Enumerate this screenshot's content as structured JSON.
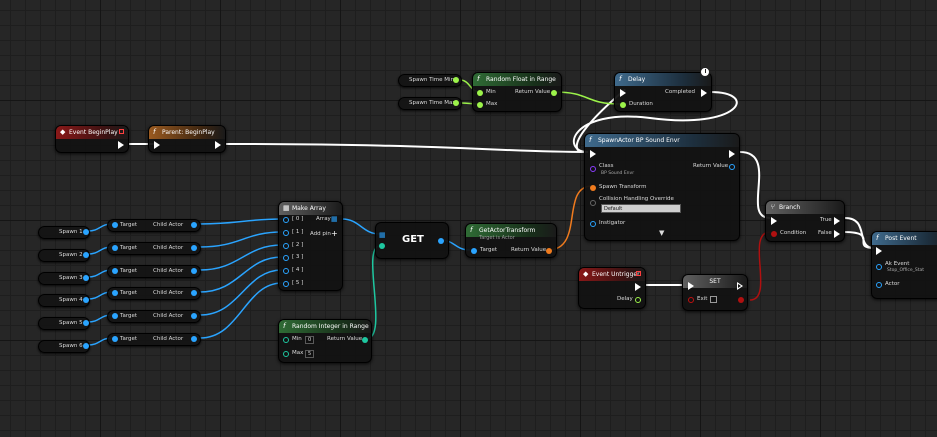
{
  "nodes": {
    "spawn_time_min": "Spawn Time Min",
    "spawn_time_max": "Spawn Time Max",
    "random_float": {
      "title": "Random Float in Range",
      "min": "Min",
      "max": "Max",
      "return": "Return Value"
    },
    "delay": {
      "title": "Delay",
      "completed": "Completed",
      "duration": "Duration"
    },
    "event_begin_play": "Event BeginPlay",
    "parent_begin_play": "Parent: BeginPlay",
    "spawn_actor": {
      "title": "SpawnActor BP Sound Envr",
      "class": "Class",
      "class_value": "BP Sound Envr",
      "return": "Return Value",
      "spawn_transform": "Spawn Transform",
      "collision": "Collision Handling Override",
      "collision_value": "Default",
      "instigator": "Instigator"
    },
    "spawns": [
      "Spawn 1",
      "Spawn 2",
      "Spawn 3",
      "Spawn 4",
      "Spawn 5",
      "Spawn 6"
    ],
    "child_actor": {
      "target": "Target",
      "child": "Child Actor"
    },
    "make_array": {
      "title": "Make Array",
      "pins": [
        "[ 0 ]",
        "[ 1 ]",
        "[ 2 ]",
        "[ 3 ]",
        "[ 4 ]",
        "[ 5 ]"
      ],
      "array": "Array",
      "add_pin": "Add pin"
    },
    "get": "GET",
    "get_actor_transform": {
      "title": "GetActorTransform",
      "subtitle": "Target is Actor",
      "target": "Target",
      "return": "Return Value"
    },
    "random_integer": {
      "title": "Random Integer in Range",
      "min": "Min",
      "min_value": "0",
      "max": "Max",
      "max_value": "5",
      "return": "Return Value"
    },
    "branch": {
      "title": "Branch",
      "condition": "Condition",
      "true": "True",
      "false": "False"
    },
    "event_untrigger": {
      "title": "Event Untrigger",
      "delay": "Delay"
    },
    "set": {
      "title": "SET",
      "exit": "Exit"
    },
    "post_event": {
      "title": "Post Event",
      "ak_event": "Ak Event",
      "ak_event_value": "Stop_Office_Stat",
      "actor": "Actor"
    }
  },
  "colors": {
    "exec": "#ffffff",
    "object": "#2aa4ff",
    "float": "#9cf34a",
    "integer": "#1ec7a0",
    "transform": "#f07b1e",
    "bool": "#b01010"
  }
}
